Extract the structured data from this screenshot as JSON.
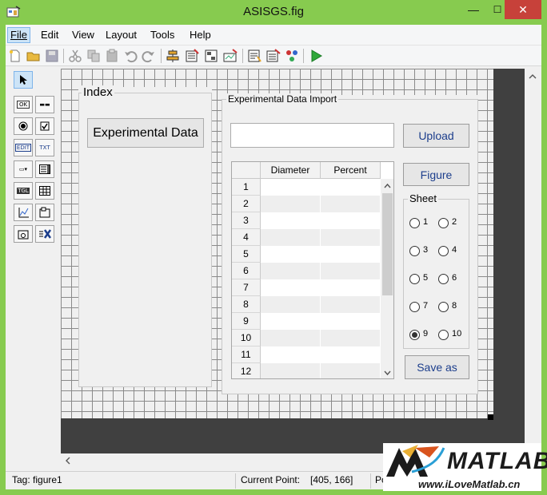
{
  "window": {
    "title": "ASISGS.fig",
    "minimize": "—",
    "maximize": "☐",
    "close": "✕"
  },
  "menu": [
    {
      "label": "File",
      "active": true
    },
    {
      "label": "Edit"
    },
    {
      "label": "View"
    },
    {
      "label": "Layout"
    },
    {
      "label": "Tools"
    },
    {
      "label": "Help"
    }
  ],
  "palette": {
    "pushbutton": "OK",
    "slider": "▬▬",
    "edit": "EDIT",
    "static": "TXT",
    "popup": "▭▾",
    "toggle": "TGL"
  },
  "figure": {
    "index_panel": {
      "title": "Index",
      "button": "Experimental Data"
    },
    "import_panel": {
      "title": "Experimental Data Import",
      "path_input_value": "",
      "upload_button": "Upload",
      "figure_button": "Figure",
      "save_button": "Save as",
      "table": {
        "columns": [
          "Diameter",
          "Percent"
        ],
        "rows": [
          "1",
          "2",
          "3",
          "4",
          "5",
          "6",
          "7",
          "8",
          "9",
          "10",
          "11",
          "12"
        ]
      },
      "sheet_group": {
        "title": "Sheet",
        "options": [
          "1",
          "2",
          "3",
          "4",
          "5",
          "6",
          "7",
          "8",
          "9",
          "10"
        ],
        "selected": "9"
      }
    }
  },
  "status": {
    "tag": "Tag: figure1",
    "current_point_label": "Current Point:",
    "current_point_value": "[405, 166]",
    "position_label": "Po"
  },
  "watermark": {
    "brand": "MATLAB",
    "url": "www.iLoveMatlab.cn"
  },
  "colors": {
    "titlebar": "#87cb4f",
    "close": "#c7413a",
    "canvas_bg": "#404040",
    "button_text": "#1c3e8c"
  }
}
